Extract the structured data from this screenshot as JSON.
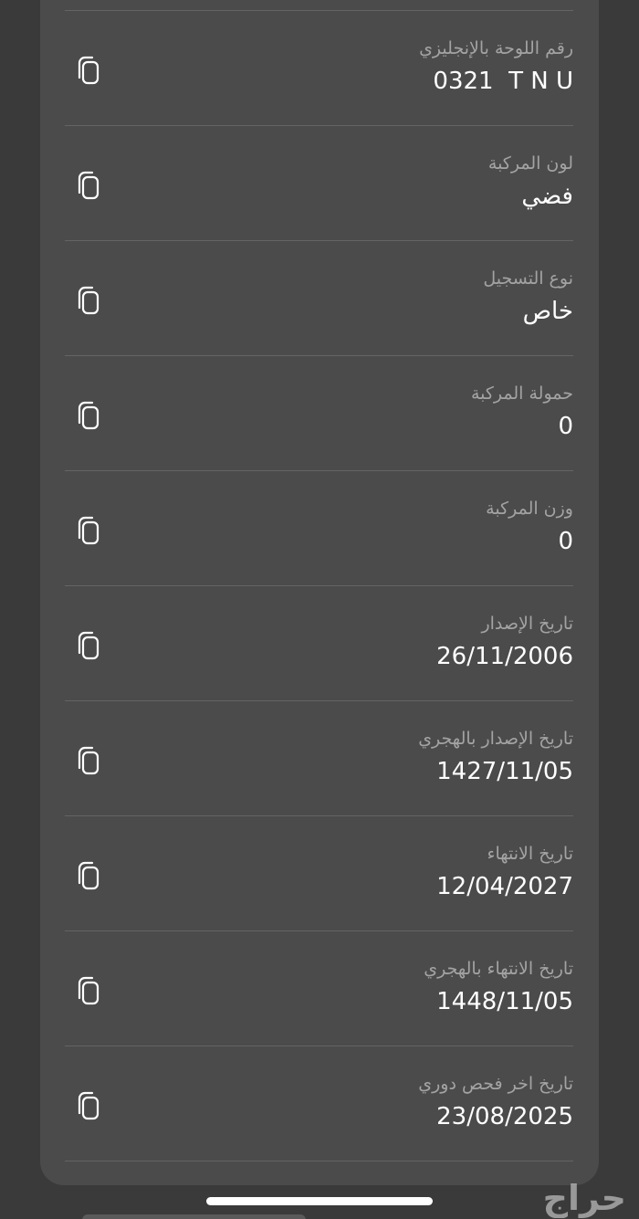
{
  "rows": [
    {
      "label": "رقم اللوحة بالإنجليزي",
      "value": "0321  T N U"
    },
    {
      "label": "لون المركبة",
      "value": "فضي"
    },
    {
      "label": "نوع التسجيل",
      "value": "خاص"
    },
    {
      "label": "حمولة المركبة",
      "value": "0"
    },
    {
      "label": "وزن المركبة",
      "value": "0"
    },
    {
      "label": "تاريخ الإصدار",
      "value": "26/11/2006"
    },
    {
      "label": "تاريخ الإصدار بالهجري",
      "value": "1427/11/05"
    },
    {
      "label": "تاريخ الانتهاء",
      "value": "12/04/2027"
    },
    {
      "label": "تاريخ الانتهاء بالهجري",
      "value": "1448/11/05"
    },
    {
      "label": "تاريخ اخر فحص دوري",
      "value": "23/08/2025"
    }
  ],
  "icons": {
    "copy": "copy-icon"
  },
  "colors": {
    "background": "#3a3a3a",
    "card": "#4b4b4b",
    "divider": "#646464",
    "label": "#a3a3a3",
    "value": "#ffffff"
  },
  "watermark": "حراج"
}
